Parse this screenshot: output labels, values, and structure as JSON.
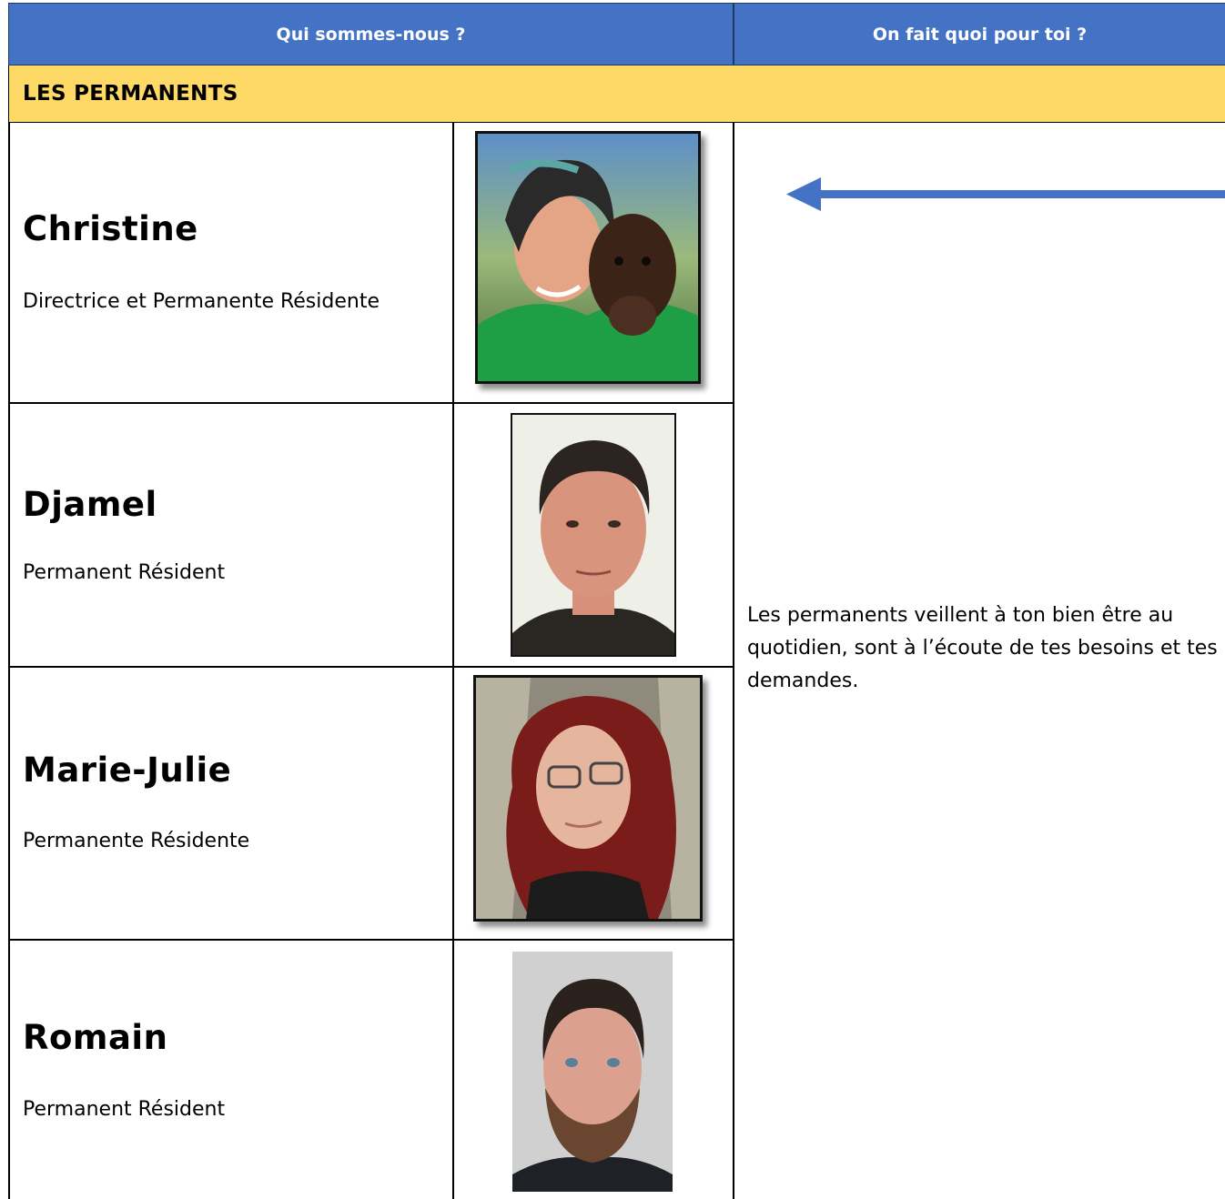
{
  "header": {
    "left_label": "Qui sommes-nous ?",
    "right_label": "On fait quoi pour toi ?"
  },
  "section": {
    "title": "LES PERMANENTS"
  },
  "members": [
    {
      "name": "Christine",
      "role": "Directrice et Permanente Résidente"
    },
    {
      "name": "Djamel",
      "role": "Permanent Résident"
    },
    {
      "name": "Marie-Julie",
      "role": "Permanente Résidente"
    },
    {
      "name": "Romain",
      "role": "Permanent Résident"
    }
  ],
  "description": "Les permanents veillent à ton bien être au quotidien, sont à l’écoute de tes besoins et tes demandes.",
  "colors": {
    "header_blue": "#4472c4",
    "section_yellow": "#ffd966",
    "arrow_blue": "#4472c4"
  },
  "icons": {
    "arrow": "left-arrow-icon"
  }
}
